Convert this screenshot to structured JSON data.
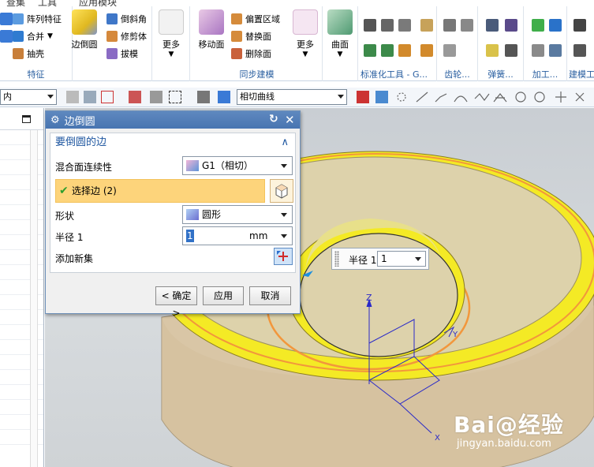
{
  "menu": [
    "查集",
    "工具",
    "应用模块"
  ],
  "ribbon": {
    "feature_group": {
      "label": "特征",
      "pattern_feature": "阵列特征",
      "unite": "合并",
      "shell": "抽壳",
      "edge_blend": "边倒圆",
      "chamfer": "倒斜角",
      "trim_body": "修剪体",
      "draft": "拔模",
      "more": "更多"
    },
    "sync_group": {
      "label": "同步建模",
      "move_face": "移动面",
      "offset_region": "偏置区域",
      "replace_face": "替换面",
      "delete_face": "删除面",
      "more": "更多"
    },
    "surface": "曲面",
    "group_labels": [
      "标准化工具 - G...",
      "齿轮...",
      "弹簧...",
      "加工...",
      "建模工"
    ]
  },
  "toolbar2": {
    "filter_combo": "内",
    "curve_rule_combo": "相切曲线"
  },
  "dialog": {
    "title": "边倒圆",
    "section_title": "要倒圆的边",
    "continuity_label": "混合面连续性",
    "continuity_value": "G1（相切）",
    "select_edge_label": "选择边 (2)",
    "shape_label": "形状",
    "shape_value": "圆形",
    "radius_label": "半径 1",
    "radius_value": "1",
    "radius_unit": "mm",
    "add_new_set_label": "添加新集",
    "ok_label": "< 确定 >",
    "apply_label": "应用",
    "cancel_label": "取消"
  },
  "radius_tip": {
    "label": "半径 1",
    "value": "1"
  },
  "axes": {
    "z": "Z",
    "y": "Y",
    "x": "X"
  },
  "watermark": {
    "brand": "Bai@经验",
    "url": "jingyan.baidu.com"
  },
  "colors": {
    "ribbon_label": "#2a5fa0",
    "dialog_title": "#4875b1",
    "selection_bar": "#fdd47b",
    "model_body": "#d9c6a6",
    "highlight_face": "#f7ef2a",
    "selected_edge": "#f2973c"
  }
}
